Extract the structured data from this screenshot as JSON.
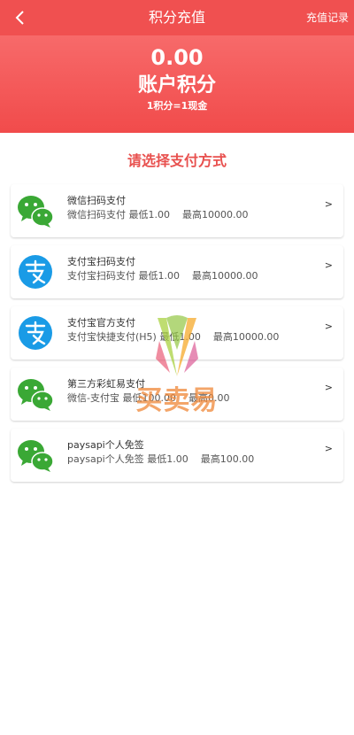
{
  "header": {
    "title": "积分充值",
    "history_link": "充值记录",
    "bg_color": "#f05050"
  },
  "balance": {
    "amount": "0.00",
    "label": "账户积分",
    "rate": "1积分=1现金"
  },
  "section_title": "请选择支付方式",
  "payment_methods": [
    {
      "icon": "wechat-icon",
      "name": "微信扫码支付",
      "desc_name": "微信扫码支付",
      "min": "最低1.00",
      "max": "最高10000.00",
      "arrow": ">"
    },
    {
      "icon": "alipay-icon",
      "name": "支付宝扫码支付",
      "desc_name": "支付宝扫码支付",
      "min": "最低1.00",
      "max": "最高10000.00",
      "arrow": ">"
    },
    {
      "icon": "alipay-icon",
      "name": "支付宝官方支付",
      "desc_name": "支付宝快捷支付(H5)",
      "min": "最低1.00",
      "max": "最高10000.00",
      "arrow": ">"
    },
    {
      "icon": "wechat-icon",
      "name": "第三方彩虹易支付",
      "desc_name": "微信-支付宝",
      "min": "最低100.00",
      "max": "最高0.00",
      "arrow": ">"
    },
    {
      "icon": "wechat-icon",
      "name": "paysapi个人免签",
      "desc_name": "paysapi个人免签",
      "min": "最低1.00",
      "max": "最高100.00",
      "arrow": ">"
    }
  ],
  "watermark": {
    "text": "买卖易"
  },
  "colors": {
    "accent": "#e8504e",
    "wechat_green": "#3aa835",
    "alipay_blue": "#1a9be6"
  }
}
